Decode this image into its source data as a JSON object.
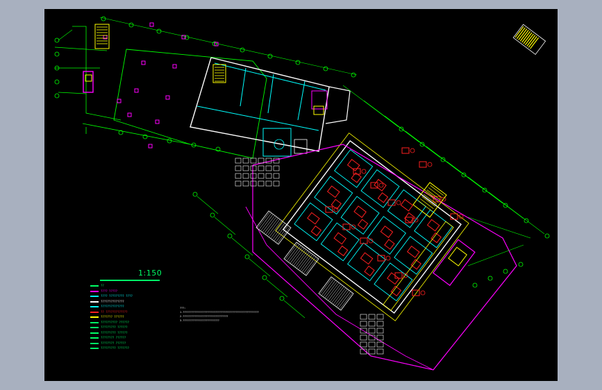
{
  "window": {
    "frame_color": "#a8b0bf",
    "canvas_color": "#000000"
  },
  "drawing": {
    "scale_text": "1:150",
    "colors": {
      "wall": "#ffffff",
      "partition": "#00ffff",
      "axis": "#00ff00",
      "furniture": "#ff2020",
      "boundary": "#ff00ff",
      "stair": "#ffff00",
      "column": "#ff00ff"
    }
  },
  "legend": {
    "items": [
      {
        "text": "??",
        "color": "#00ff66"
      },
      {
        "text": "????  ?????",
        "color": "#ff00ff"
      },
      {
        "text": "????  ?????????   ????",
        "color": "#00ffff"
      },
      {
        "text": "??????????????",
        "color": "#ffffff"
      },
      {
        "text": "??????????????",
        "color": "#00ffff"
      },
      {
        "text": "?? ?????????????",
        "color": "#ff2020"
      },
      {
        "text": "??????? ??????",
        "color": "#ffff00"
      },
      {
        "text": "?????????? ??????",
        "color": "#00ff66"
      },
      {
        "text": "????????? ??????",
        "color": "#00ff66"
      },
      {
        "text": "?????????  ??????",
        "color": "#00ff66"
      },
      {
        "text": "????????  ??????",
        "color": "#00ff66"
      },
      {
        "text": "????????  ??????",
        "color": "#00ff66"
      },
      {
        "text": "?????????  ???????",
        "color": "#00ff66"
      }
    ]
  },
  "notes": {
    "lines": [
      "???:",
      "1.????????????????????????????????????????????????????",
      "2.???????????????????????????????",
      "3.?????????????????????????"
    ]
  }
}
